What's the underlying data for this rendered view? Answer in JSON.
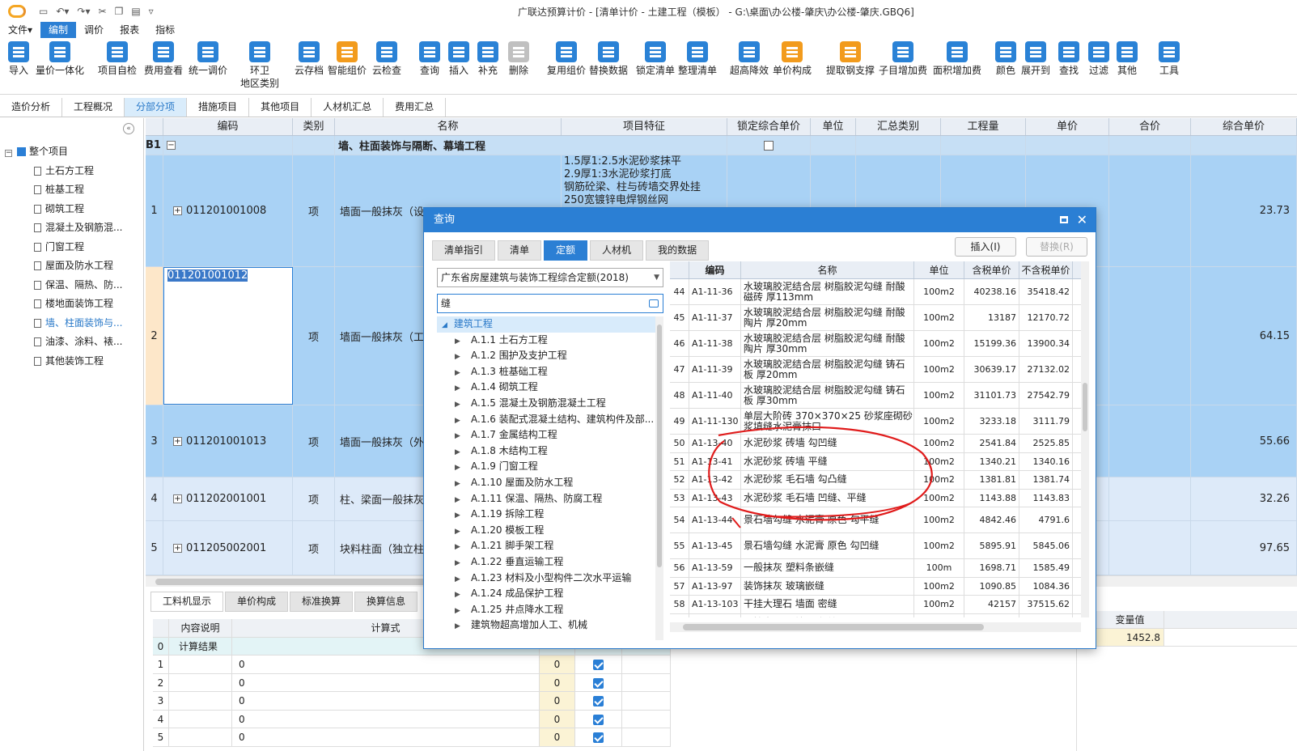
{
  "app": {
    "title": "广联达预算计价 - [清单计价 - 土建工程（模板） - G:\\桌面\\办公楼-肇庆\\办公楼-肇庆.GBQ6]"
  },
  "menu": [
    {
      "label": "文件▾"
    },
    {
      "label": "编制"
    },
    {
      "label": "调价"
    },
    {
      "label": "报表"
    },
    {
      "label": "指标"
    }
  ],
  "ribbon": [
    {
      "label": "导入",
      "c": "b"
    },
    {
      "label": "量价一体化",
      "c": "b"
    },
    {
      "label": "项目自检",
      "c": "b"
    },
    {
      "label": "费用查看",
      "c": "b"
    },
    {
      "label": "统一调价",
      "c": "b"
    },
    {
      "label": "环卫",
      "label2": "地区类别",
      "c": "b"
    },
    {
      "label": "云存档",
      "c": "b"
    },
    {
      "label": "智能组价",
      "c": "o"
    },
    {
      "label": "云检查",
      "c": "b"
    },
    {
      "label": "查询",
      "c": "b"
    },
    {
      "label": "插入",
      "c": "b"
    },
    {
      "label": "补充",
      "c": "b"
    },
    {
      "label": "删除",
      "c": "g"
    },
    {
      "label": "复用组价",
      "c": "b"
    },
    {
      "label": "替换数据",
      "c": "b"
    },
    {
      "label": "锁定清单",
      "c": "b"
    },
    {
      "label": "整理清单",
      "c": "b"
    },
    {
      "label": "超高降效",
      "c": "b"
    },
    {
      "label": "单价构成",
      "c": "o"
    },
    {
      "label": "提取钢支撑",
      "c": "o"
    },
    {
      "label": "子目增加费",
      "c": "b"
    },
    {
      "label": "面积增加费",
      "c": "b"
    },
    {
      "label": "颜色",
      "c": "b"
    },
    {
      "label": "展开到",
      "c": "b"
    },
    {
      "label": "查找",
      "c": "b"
    },
    {
      "label": "过滤",
      "c": "b"
    },
    {
      "label": "其他",
      "c": "b"
    },
    {
      "label": "工具",
      "c": "b"
    }
  ],
  "tabs": [
    "造价分析",
    "工程概况",
    "分部分项",
    "措施项目",
    "其他项目",
    "人材机汇总",
    "费用汇总"
  ],
  "tree": {
    "root": "整个项目",
    "items": [
      "土石方工程",
      "桩基工程",
      "砌筑工程",
      "混凝土及钢筋混...",
      "门窗工程",
      "屋面及防水工程",
      "保温、隔热、防...",
      "楼地面装饰工程",
      "墙、柱面装饰与...",
      "油漆、涂料、裱...",
      "其他装饰工程"
    ]
  },
  "grid": {
    "headers": [
      "",
      "编码",
      "类别",
      "名称",
      "项目特征",
      "锁定综合单价",
      "单位",
      "汇总类别",
      "工程量",
      "单价",
      "合价",
      "综合单价"
    ],
    "section": {
      "label": "B1",
      "name": "墙、柱面装饰与隔断、幕墙工程"
    },
    "rows": [
      {
        "no": "1",
        "code": "011201001008",
        "type": "项",
        "name": "墙面一般抹灰（设",
        "feature1": "1.5厚1:2.5水泥砂浆抹平",
        "feature2": "2.9厚1:3水泥砂浆打底",
        "feature3": "钢筋砼梁、柱与砖墙交界处挂",
        "feature4": "250宽镀锌电焊钢丝网",
        "price": "23.73"
      },
      {
        "no": "2",
        "code": "011201001012",
        "type": "项",
        "name": "墙面一般抹灰（工",
        "price": "64.15"
      },
      {
        "no": "3",
        "code": "011201001013",
        "type": "项",
        "name": "墙面一般抹灰（外",
        "price": "55.66"
      },
      {
        "no": "4",
        "code": "011202001001",
        "type": "项",
        "name": "柱、梁面一般抹灰",
        "price": "32.26"
      },
      {
        "no": "5",
        "code": "011205002001",
        "type": "项",
        "name": "块料柱面（独立柱",
        "price": "97.65"
      }
    ]
  },
  "bottom": {
    "tabs": [
      "工料机显示",
      "单价构成",
      "标准换算",
      "换算信息"
    ],
    "headers": [
      "",
      "内容说明",
      "计算式"
    ],
    "rows": [
      {
        "no": "0",
        "desc": "计算结果",
        "expr": "",
        "val": ""
      },
      {
        "no": "1",
        "desc": "",
        "expr": "0",
        "val": "0"
      },
      {
        "no": "2",
        "desc": "",
        "expr": "0",
        "val": "0"
      },
      {
        "no": "3",
        "desc": "",
        "expr": "0",
        "val": "0"
      },
      {
        "no": "4",
        "desc": "",
        "expr": "0",
        "val": "0"
      },
      {
        "no": "5",
        "desc": "",
        "expr": "0",
        "val": "0"
      }
    ],
    "right_header": "变量值",
    "right_value": "1452.8"
  },
  "dialog": {
    "title": "查询",
    "tabs": [
      "清单指引",
      "清单",
      "定额",
      "人材机",
      "我的数据"
    ],
    "insert": "插入(I)",
    "replace": "替换(R)",
    "library": "广东省房屋建筑与装饰工程综合定额(2018)",
    "search": "缝",
    "tree_root": "建筑工程",
    "tree": [
      "A.1.1 土石方工程",
      "A.1.2 围护及支护工程",
      "A.1.3 桩基础工程",
      "A.1.4 砌筑工程",
      "A.1.5 混凝土及钢筋混凝土工程",
      "A.1.6 装配式混凝土结构、建筑构件及部...",
      "A.1.7 金属结构工程",
      "A.1.8 木结构工程",
      "A.1.9 门窗工程",
      "A.1.10 屋面及防水工程",
      "A.1.11 保温、隔热、防腐工程",
      "A.1.19 拆除工程",
      "A.1.20 模板工程",
      "A.1.21 脚手架工程",
      "A.1.22 垂直运输工程",
      "A.1.23 材料及小型构件二次水平运输",
      "A.1.24 成品保护工程",
      "A.1.25 井点降水工程",
      "建筑物超高增加人工、机械"
    ],
    "headers": [
      "",
      "编码",
      "名称",
      "单位",
      "含税单价",
      "不含税单价"
    ],
    "rows": [
      {
        "no": "44",
        "code": "A1-11-36",
        "name": "水玻璃胶泥结合层 树脂胶泥勾缝 耐酸磁砖 厚113mm",
        "unit": "100m2",
        "tax": "40238.16",
        "notax": "35418.42"
      },
      {
        "no": "45",
        "code": "A1-11-37",
        "name": "水玻璃胶泥结合层 树脂胶泥勾缝 耐酸陶片 厚20mm",
        "unit": "100m2",
        "tax": "13187",
        "notax": "12170.72"
      },
      {
        "no": "46",
        "code": "A1-11-38",
        "name": "水玻璃胶泥结合层 树脂胶泥勾缝 耐酸陶片 厚30mm",
        "unit": "100m2",
        "tax": "15199.36",
        "notax": "13900.34"
      },
      {
        "no": "47",
        "code": "A1-11-39",
        "name": "水玻璃胶泥结合层 树脂胶泥勾缝 铸石板 厚20mm",
        "unit": "100m2",
        "tax": "30639.17",
        "notax": "27132.02"
      },
      {
        "no": "48",
        "code": "A1-11-40",
        "name": "水玻璃胶泥结合层 树脂胶泥勾缝 铸石板 厚30mm",
        "unit": "100m2",
        "tax": "31101.73",
        "notax": "27542.79"
      },
      {
        "no": "49",
        "code": "A1-11-130",
        "name": "单层大阶砖 370×370×25 砂浆座砌砂浆填缝水泥膏抹口",
        "unit": "100m2",
        "tax": "3233.18",
        "notax": "3111.79"
      },
      {
        "no": "50",
        "code": "A1-13-40",
        "name": "水泥砂浆 砖墙 勾凹缝",
        "unit": "100m2",
        "tax": "2541.84",
        "notax": "2525.85"
      },
      {
        "no": "51",
        "code": "A1-13-41",
        "name": "水泥砂浆 砖墙 平缝",
        "unit": "100m2",
        "tax": "1340.21",
        "notax": "1340.16"
      },
      {
        "no": "52",
        "code": "A1-13-42",
        "name": "水泥砂浆 毛石墙 勾凸缝",
        "unit": "100m2",
        "tax": "1381.81",
        "notax": "1381.74"
      },
      {
        "no": "53",
        "code": "A1-13-43",
        "name": "水泥砂浆 毛石墙 凹缝、平缝",
        "unit": "100m2",
        "tax": "1143.88",
        "notax": "1143.83"
      },
      {
        "no": "54",
        "code": "A1-13-44",
        "name": "景石墙勾缝 水泥膏 原色 勾平缝",
        "unit": "100m2",
        "tax": "4842.46",
        "notax": "4791.6"
      },
      {
        "no": "55",
        "code": "A1-13-45",
        "name": "景石墙勾缝 水泥膏 原色 勾凹缝",
        "unit": "100m2",
        "tax": "5895.91",
        "notax": "5845.06"
      },
      {
        "no": "56",
        "code": "A1-13-59",
        "name": "一般抹灰 塑料条嵌缝",
        "unit": "100m",
        "tax": "1698.71",
        "notax": "1585.49"
      },
      {
        "no": "57",
        "code": "A1-13-97",
        "name": "装饰抹灰 玻璃嵌缝",
        "unit": "100m2",
        "tax": "1090.85",
        "notax": "1084.36"
      },
      {
        "no": "58",
        "code": "A1-13-103",
        "name": "干挂大理石 墙面 密缝",
        "unit": "100m2",
        "tax": "42157",
        "notax": "37515.62"
      },
      {
        "no": "59",
        "code": "A1-13-104",
        "name": "干挂大理石 墙面 勾缝",
        "unit": "100m2",
        "tax": "44310.85",
        "notax": "39697.21"
      }
    ]
  }
}
